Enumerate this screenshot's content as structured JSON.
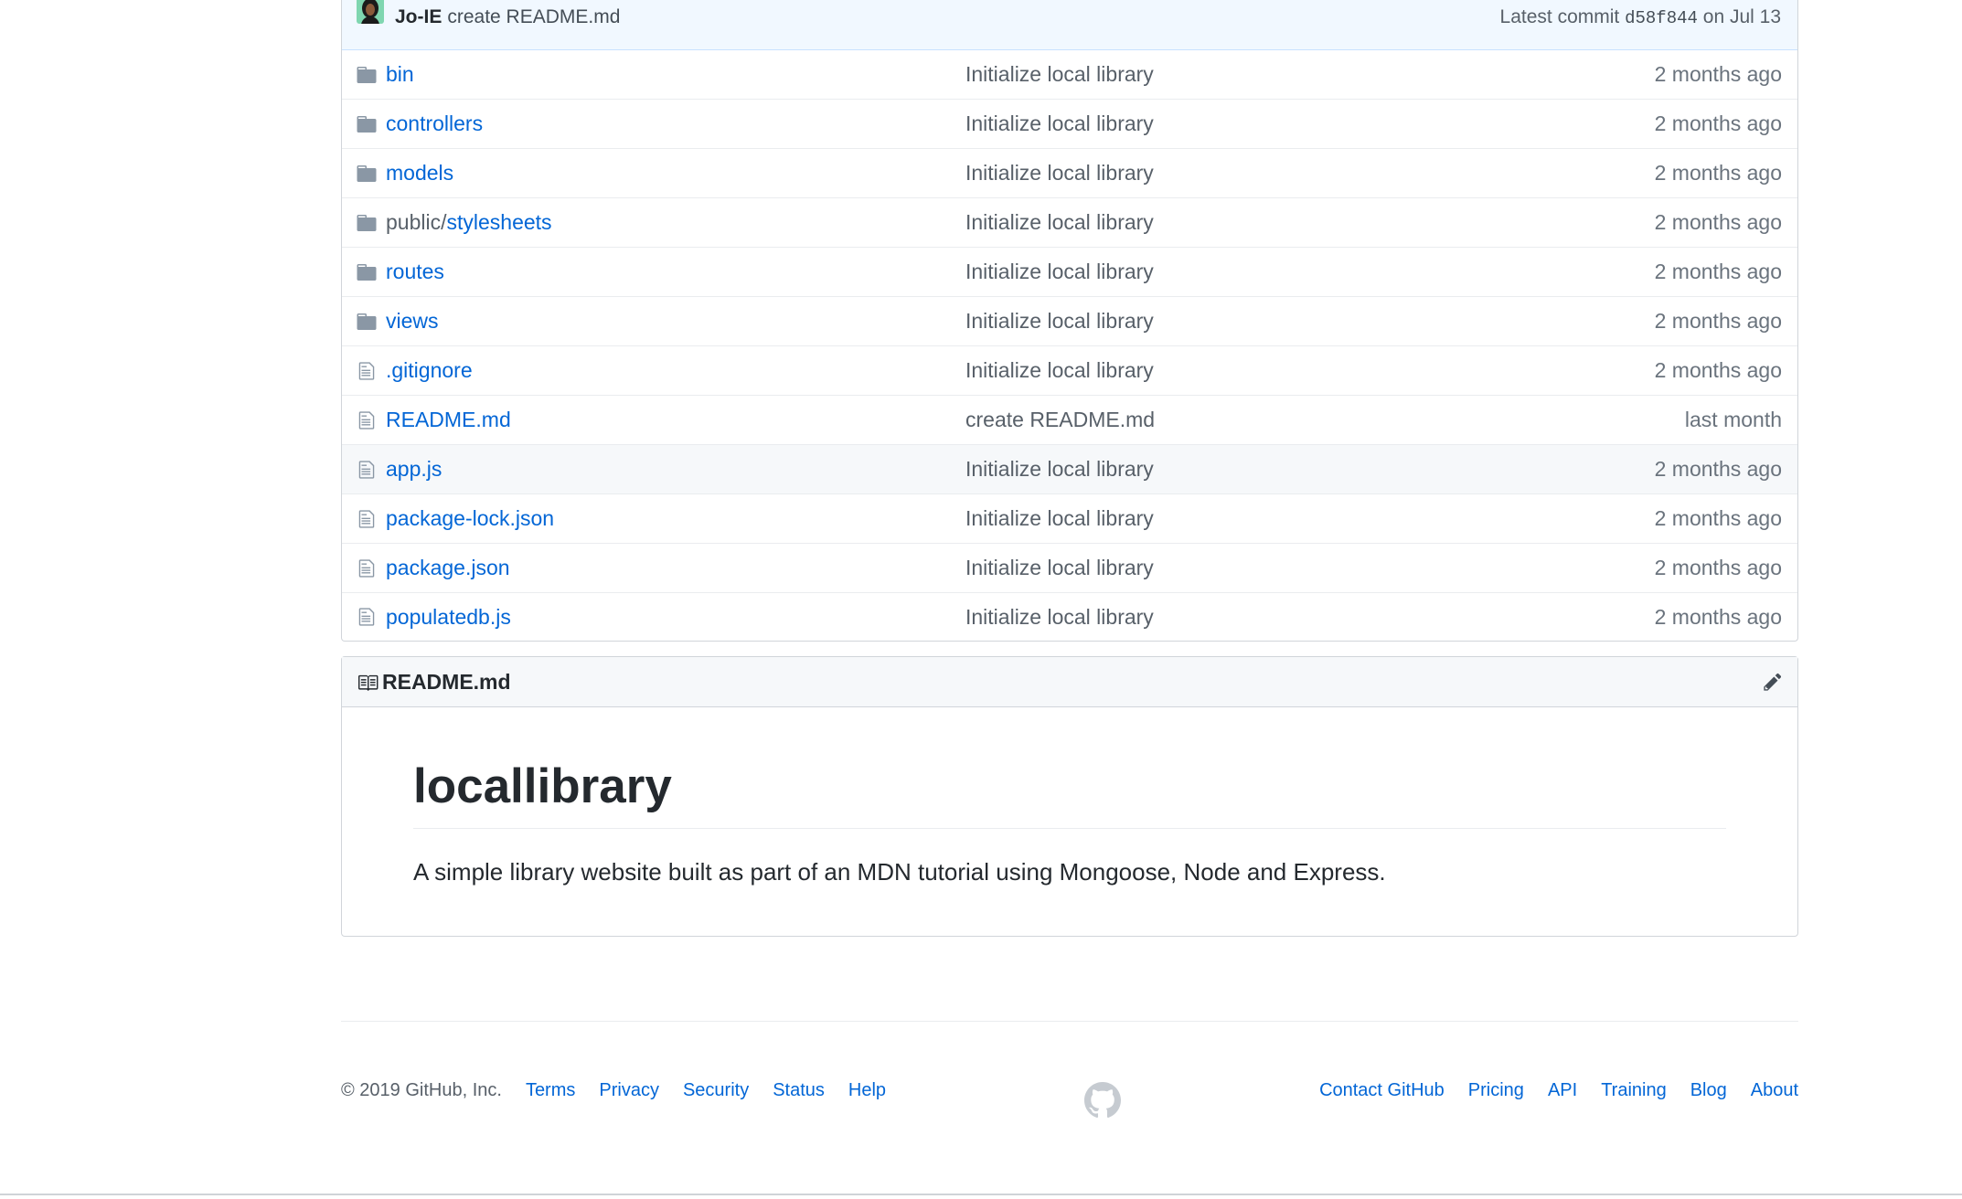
{
  "commit_bar": {
    "author": "Jo-IE",
    "message": "create README.md",
    "latest_label": "Latest commit",
    "sha": "d58f844",
    "date": "on Jul 13"
  },
  "files": [
    {
      "type": "dir",
      "prefix": "",
      "name": "bin",
      "message": "Initialize local library",
      "age": "2 months ago"
    },
    {
      "type": "dir",
      "prefix": "",
      "name": "controllers",
      "message": "Initialize local library",
      "age": "2 months ago"
    },
    {
      "type": "dir",
      "prefix": "",
      "name": "models",
      "message": "Initialize local library",
      "age": "2 months ago"
    },
    {
      "type": "dir",
      "prefix": "public/",
      "name": "stylesheets",
      "message": "Initialize local library",
      "age": "2 months ago"
    },
    {
      "type": "dir",
      "prefix": "",
      "name": "routes",
      "message": "Initialize local library",
      "age": "2 months ago"
    },
    {
      "type": "dir",
      "prefix": "",
      "name": "views",
      "message": "Initialize local library",
      "age": "2 months ago"
    },
    {
      "type": "file",
      "prefix": "",
      "name": ".gitignore",
      "message": "Initialize local library",
      "age": "2 months ago"
    },
    {
      "type": "file",
      "prefix": "",
      "name": "README.md",
      "message": "create README.md",
      "age": "last month"
    },
    {
      "type": "file",
      "prefix": "",
      "name": "app.js",
      "message": "Initialize local library",
      "age": "2 months ago"
    },
    {
      "type": "file",
      "prefix": "",
      "name": "package-lock.json",
      "message": "Initialize local library",
      "age": "2 months ago"
    },
    {
      "type": "file",
      "prefix": "",
      "name": "package.json",
      "message": "Initialize local library",
      "age": "2 months ago"
    },
    {
      "type": "file",
      "prefix": "",
      "name": "populatedb.js",
      "message": "Initialize local library",
      "age": "2 months ago"
    }
  ],
  "readme": {
    "filename": "README.md",
    "title": "locallibrary",
    "description": "A simple library website built as part of an MDN tutorial using Mongoose, Node and Express."
  },
  "footer": {
    "copyright": "© 2019 GitHub, Inc.",
    "left_links": [
      "Terms",
      "Privacy",
      "Security",
      "Status",
      "Help"
    ],
    "right_links": [
      "Contact GitHub",
      "Pricing",
      "API",
      "Training",
      "Blog",
      "About"
    ]
  },
  "colors": {
    "link": "#0366d6",
    "icon": "#8a97a5",
    "commit_bar_bg": "#f1f8ff"
  },
  "icons": {
    "directory": "folder-icon",
    "file": "file-icon",
    "readme": "book-icon",
    "edit": "pencil-icon",
    "footer_logo": "github-mark-icon"
  }
}
